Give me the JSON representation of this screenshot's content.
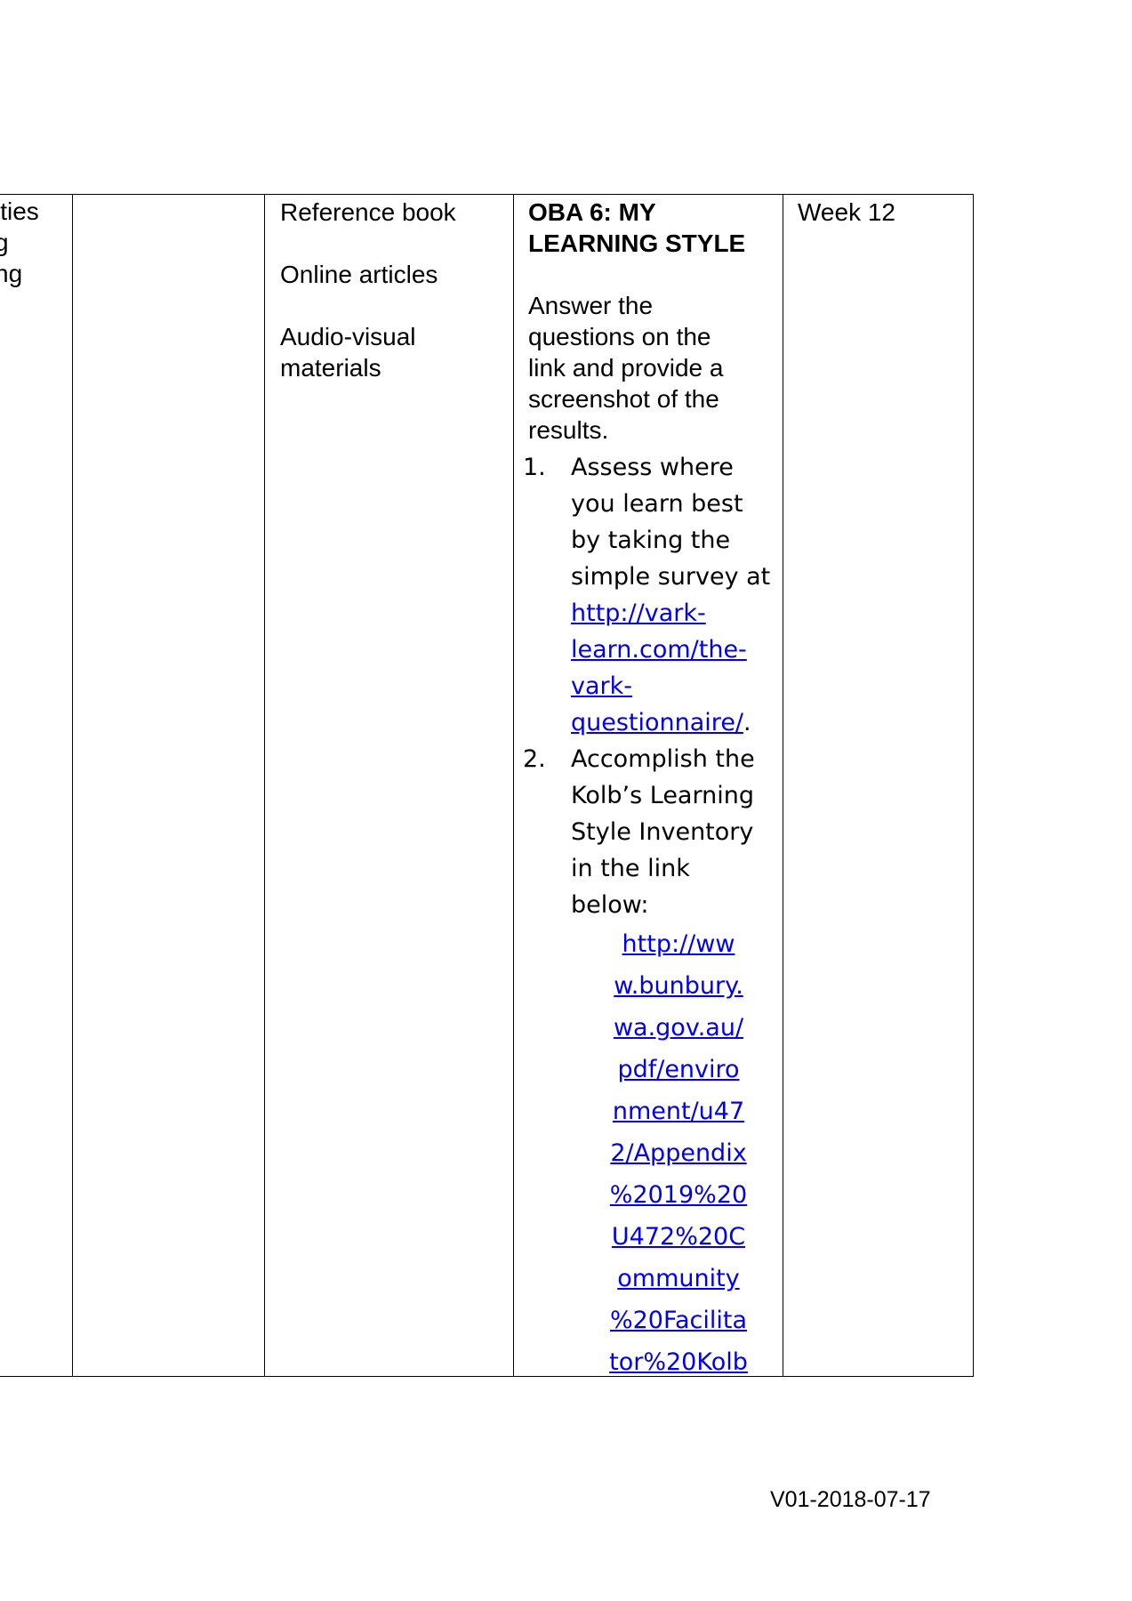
{
  "table": {
    "col0_fragments": [
      "ities",
      "",
      "",
      "g",
      "",
      "ng"
    ],
    "resources": [
      "Reference book",
      "Online articles",
      "Audio-visual materials"
    ],
    "activity": {
      "heading_line1": "OBA 6: MY",
      "heading_line2": "LEARNING STYLE",
      "instructions": [
        "Answer the",
        "questions on the",
        "link and provide a",
        "screenshot of the",
        "results."
      ],
      "step1": {
        "number": "1.",
        "text_lines": [
          "Assess where",
          "you learn best",
          "by taking the",
          "simple survey at"
        ],
        "link_lines": [
          "http://vark-",
          "learn.com/the-",
          "vark-",
          "questionnaire/"
        ],
        "trailing": "."
      },
      "step2": {
        "number": "2.",
        "text_lines": [
          "Accomplish the",
          "Kolb’s Learning",
          "Style Inventory",
          "in the link",
          "below:"
        ],
        "link_lines": [
          "http://ww",
          "w.bunbury.",
          "wa.gov.au/",
          "pdf/enviro",
          "nment/u47",
          "2/Appendix",
          "%2019%20",
          "U472%20C",
          "ommunity",
          "%20Facilita",
          "tor%20Kolb"
        ]
      }
    },
    "schedule": "Week 12"
  },
  "footer": {
    "version": "V01-2018-07-17"
  },
  "colors": {
    "link": "#0000ee",
    "border": "#000000"
  }
}
